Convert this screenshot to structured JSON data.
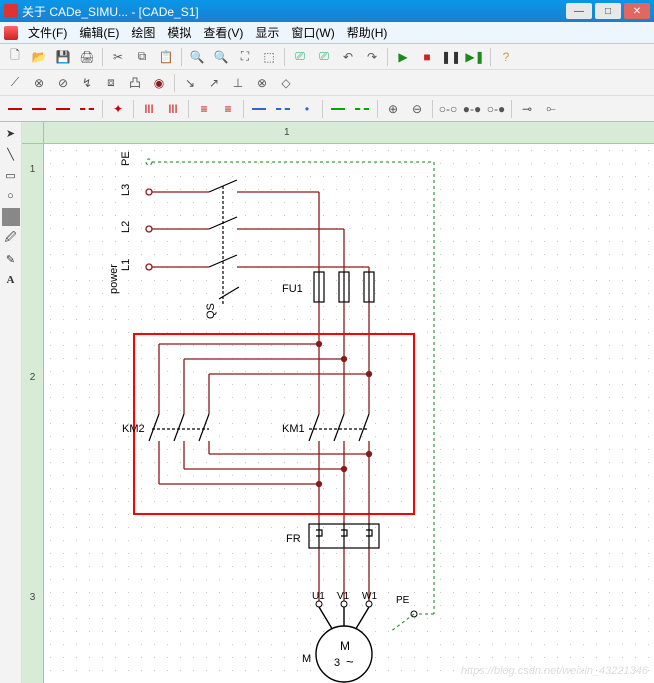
{
  "window": {
    "title": "关于 CADe_SIMU...  - [CADe_S1]"
  },
  "menu": {
    "file": "文件(F)",
    "edit": "编辑(E)",
    "draw": "绘图",
    "simulate": "模拟",
    "view": "查看(V)",
    "display": "显示",
    "window": "窗口(W)",
    "help": "帮助(H)"
  },
  "ruler": {
    "h1": "1",
    "v1": "1",
    "v2": "2",
    "v3": "3"
  },
  "circuit": {
    "pe": "PE",
    "l3": "L3",
    "l2": "L2",
    "l1": "L1",
    "power": "power",
    "qs": "QS",
    "fu1": "FU1",
    "km1": "KM1",
    "km2": "KM2",
    "fr": "FR",
    "u1": "U1",
    "v1": "V1",
    "w1": "W1",
    "pe2": "PE",
    "m": "M",
    "m2": "M",
    "three": "3",
    "sine": "~"
  },
  "watermark": "https://blog.csdn.net/weixin_43221346",
  "colors": {
    "wire": "#8a1a1a",
    "green": "#0a8a0a",
    "redbox": "#ff0000"
  }
}
